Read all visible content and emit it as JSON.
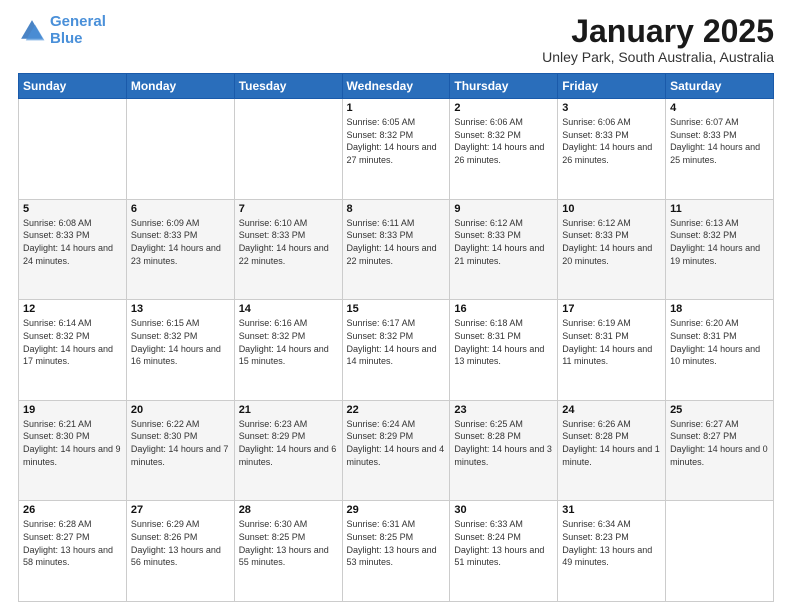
{
  "logo": {
    "line1": "General",
    "line2": "Blue"
  },
  "title": "January 2025",
  "location": "Unley Park, South Australia, Australia",
  "weekdays": [
    "Sunday",
    "Monday",
    "Tuesday",
    "Wednesday",
    "Thursday",
    "Friday",
    "Saturday"
  ],
  "weeks": [
    [
      {
        "day": "",
        "sunrise": "",
        "sunset": "",
        "daylight": ""
      },
      {
        "day": "",
        "sunrise": "",
        "sunset": "",
        "daylight": ""
      },
      {
        "day": "",
        "sunrise": "",
        "sunset": "",
        "daylight": ""
      },
      {
        "day": "1",
        "sunrise": "Sunrise: 6:05 AM",
        "sunset": "Sunset: 8:32 PM",
        "daylight": "Daylight: 14 hours and 27 minutes."
      },
      {
        "day": "2",
        "sunrise": "Sunrise: 6:06 AM",
        "sunset": "Sunset: 8:32 PM",
        "daylight": "Daylight: 14 hours and 26 minutes."
      },
      {
        "day": "3",
        "sunrise": "Sunrise: 6:06 AM",
        "sunset": "Sunset: 8:33 PM",
        "daylight": "Daylight: 14 hours and 26 minutes."
      },
      {
        "day": "4",
        "sunrise": "Sunrise: 6:07 AM",
        "sunset": "Sunset: 8:33 PM",
        "daylight": "Daylight: 14 hours and 25 minutes."
      }
    ],
    [
      {
        "day": "5",
        "sunrise": "Sunrise: 6:08 AM",
        "sunset": "Sunset: 8:33 PM",
        "daylight": "Daylight: 14 hours and 24 minutes."
      },
      {
        "day": "6",
        "sunrise": "Sunrise: 6:09 AM",
        "sunset": "Sunset: 8:33 PM",
        "daylight": "Daylight: 14 hours and 23 minutes."
      },
      {
        "day": "7",
        "sunrise": "Sunrise: 6:10 AM",
        "sunset": "Sunset: 8:33 PM",
        "daylight": "Daylight: 14 hours and 22 minutes."
      },
      {
        "day": "8",
        "sunrise": "Sunrise: 6:11 AM",
        "sunset": "Sunset: 8:33 PM",
        "daylight": "Daylight: 14 hours and 22 minutes."
      },
      {
        "day": "9",
        "sunrise": "Sunrise: 6:12 AM",
        "sunset": "Sunset: 8:33 PM",
        "daylight": "Daylight: 14 hours and 21 minutes."
      },
      {
        "day": "10",
        "sunrise": "Sunrise: 6:12 AM",
        "sunset": "Sunset: 8:33 PM",
        "daylight": "Daylight: 14 hours and 20 minutes."
      },
      {
        "day": "11",
        "sunrise": "Sunrise: 6:13 AM",
        "sunset": "Sunset: 8:32 PM",
        "daylight": "Daylight: 14 hours and 19 minutes."
      }
    ],
    [
      {
        "day": "12",
        "sunrise": "Sunrise: 6:14 AM",
        "sunset": "Sunset: 8:32 PM",
        "daylight": "Daylight: 14 hours and 17 minutes."
      },
      {
        "day": "13",
        "sunrise": "Sunrise: 6:15 AM",
        "sunset": "Sunset: 8:32 PM",
        "daylight": "Daylight: 14 hours and 16 minutes."
      },
      {
        "day": "14",
        "sunrise": "Sunrise: 6:16 AM",
        "sunset": "Sunset: 8:32 PM",
        "daylight": "Daylight: 14 hours and 15 minutes."
      },
      {
        "day": "15",
        "sunrise": "Sunrise: 6:17 AM",
        "sunset": "Sunset: 8:32 PM",
        "daylight": "Daylight: 14 hours and 14 minutes."
      },
      {
        "day": "16",
        "sunrise": "Sunrise: 6:18 AM",
        "sunset": "Sunset: 8:31 PM",
        "daylight": "Daylight: 14 hours and 13 minutes."
      },
      {
        "day": "17",
        "sunrise": "Sunrise: 6:19 AM",
        "sunset": "Sunset: 8:31 PM",
        "daylight": "Daylight: 14 hours and 11 minutes."
      },
      {
        "day": "18",
        "sunrise": "Sunrise: 6:20 AM",
        "sunset": "Sunset: 8:31 PM",
        "daylight": "Daylight: 14 hours and 10 minutes."
      }
    ],
    [
      {
        "day": "19",
        "sunrise": "Sunrise: 6:21 AM",
        "sunset": "Sunset: 8:30 PM",
        "daylight": "Daylight: 14 hours and 9 minutes."
      },
      {
        "day": "20",
        "sunrise": "Sunrise: 6:22 AM",
        "sunset": "Sunset: 8:30 PM",
        "daylight": "Daylight: 14 hours and 7 minutes."
      },
      {
        "day": "21",
        "sunrise": "Sunrise: 6:23 AM",
        "sunset": "Sunset: 8:29 PM",
        "daylight": "Daylight: 14 hours and 6 minutes."
      },
      {
        "day": "22",
        "sunrise": "Sunrise: 6:24 AM",
        "sunset": "Sunset: 8:29 PM",
        "daylight": "Daylight: 14 hours and 4 minutes."
      },
      {
        "day": "23",
        "sunrise": "Sunrise: 6:25 AM",
        "sunset": "Sunset: 8:28 PM",
        "daylight": "Daylight: 14 hours and 3 minutes."
      },
      {
        "day": "24",
        "sunrise": "Sunrise: 6:26 AM",
        "sunset": "Sunset: 8:28 PM",
        "daylight": "Daylight: 14 hours and 1 minute."
      },
      {
        "day": "25",
        "sunrise": "Sunrise: 6:27 AM",
        "sunset": "Sunset: 8:27 PM",
        "daylight": "Daylight: 14 hours and 0 minutes."
      }
    ],
    [
      {
        "day": "26",
        "sunrise": "Sunrise: 6:28 AM",
        "sunset": "Sunset: 8:27 PM",
        "daylight": "Daylight: 13 hours and 58 minutes."
      },
      {
        "day": "27",
        "sunrise": "Sunrise: 6:29 AM",
        "sunset": "Sunset: 8:26 PM",
        "daylight": "Daylight: 13 hours and 56 minutes."
      },
      {
        "day": "28",
        "sunrise": "Sunrise: 6:30 AM",
        "sunset": "Sunset: 8:25 PM",
        "daylight": "Daylight: 13 hours and 55 minutes."
      },
      {
        "day": "29",
        "sunrise": "Sunrise: 6:31 AM",
        "sunset": "Sunset: 8:25 PM",
        "daylight": "Daylight: 13 hours and 53 minutes."
      },
      {
        "day": "30",
        "sunrise": "Sunrise: 6:33 AM",
        "sunset": "Sunset: 8:24 PM",
        "daylight": "Daylight: 13 hours and 51 minutes."
      },
      {
        "day": "31",
        "sunrise": "Sunrise: 6:34 AM",
        "sunset": "Sunset: 8:23 PM",
        "daylight": "Daylight: 13 hours and 49 minutes."
      },
      {
        "day": "",
        "sunrise": "",
        "sunset": "",
        "daylight": ""
      }
    ]
  ]
}
